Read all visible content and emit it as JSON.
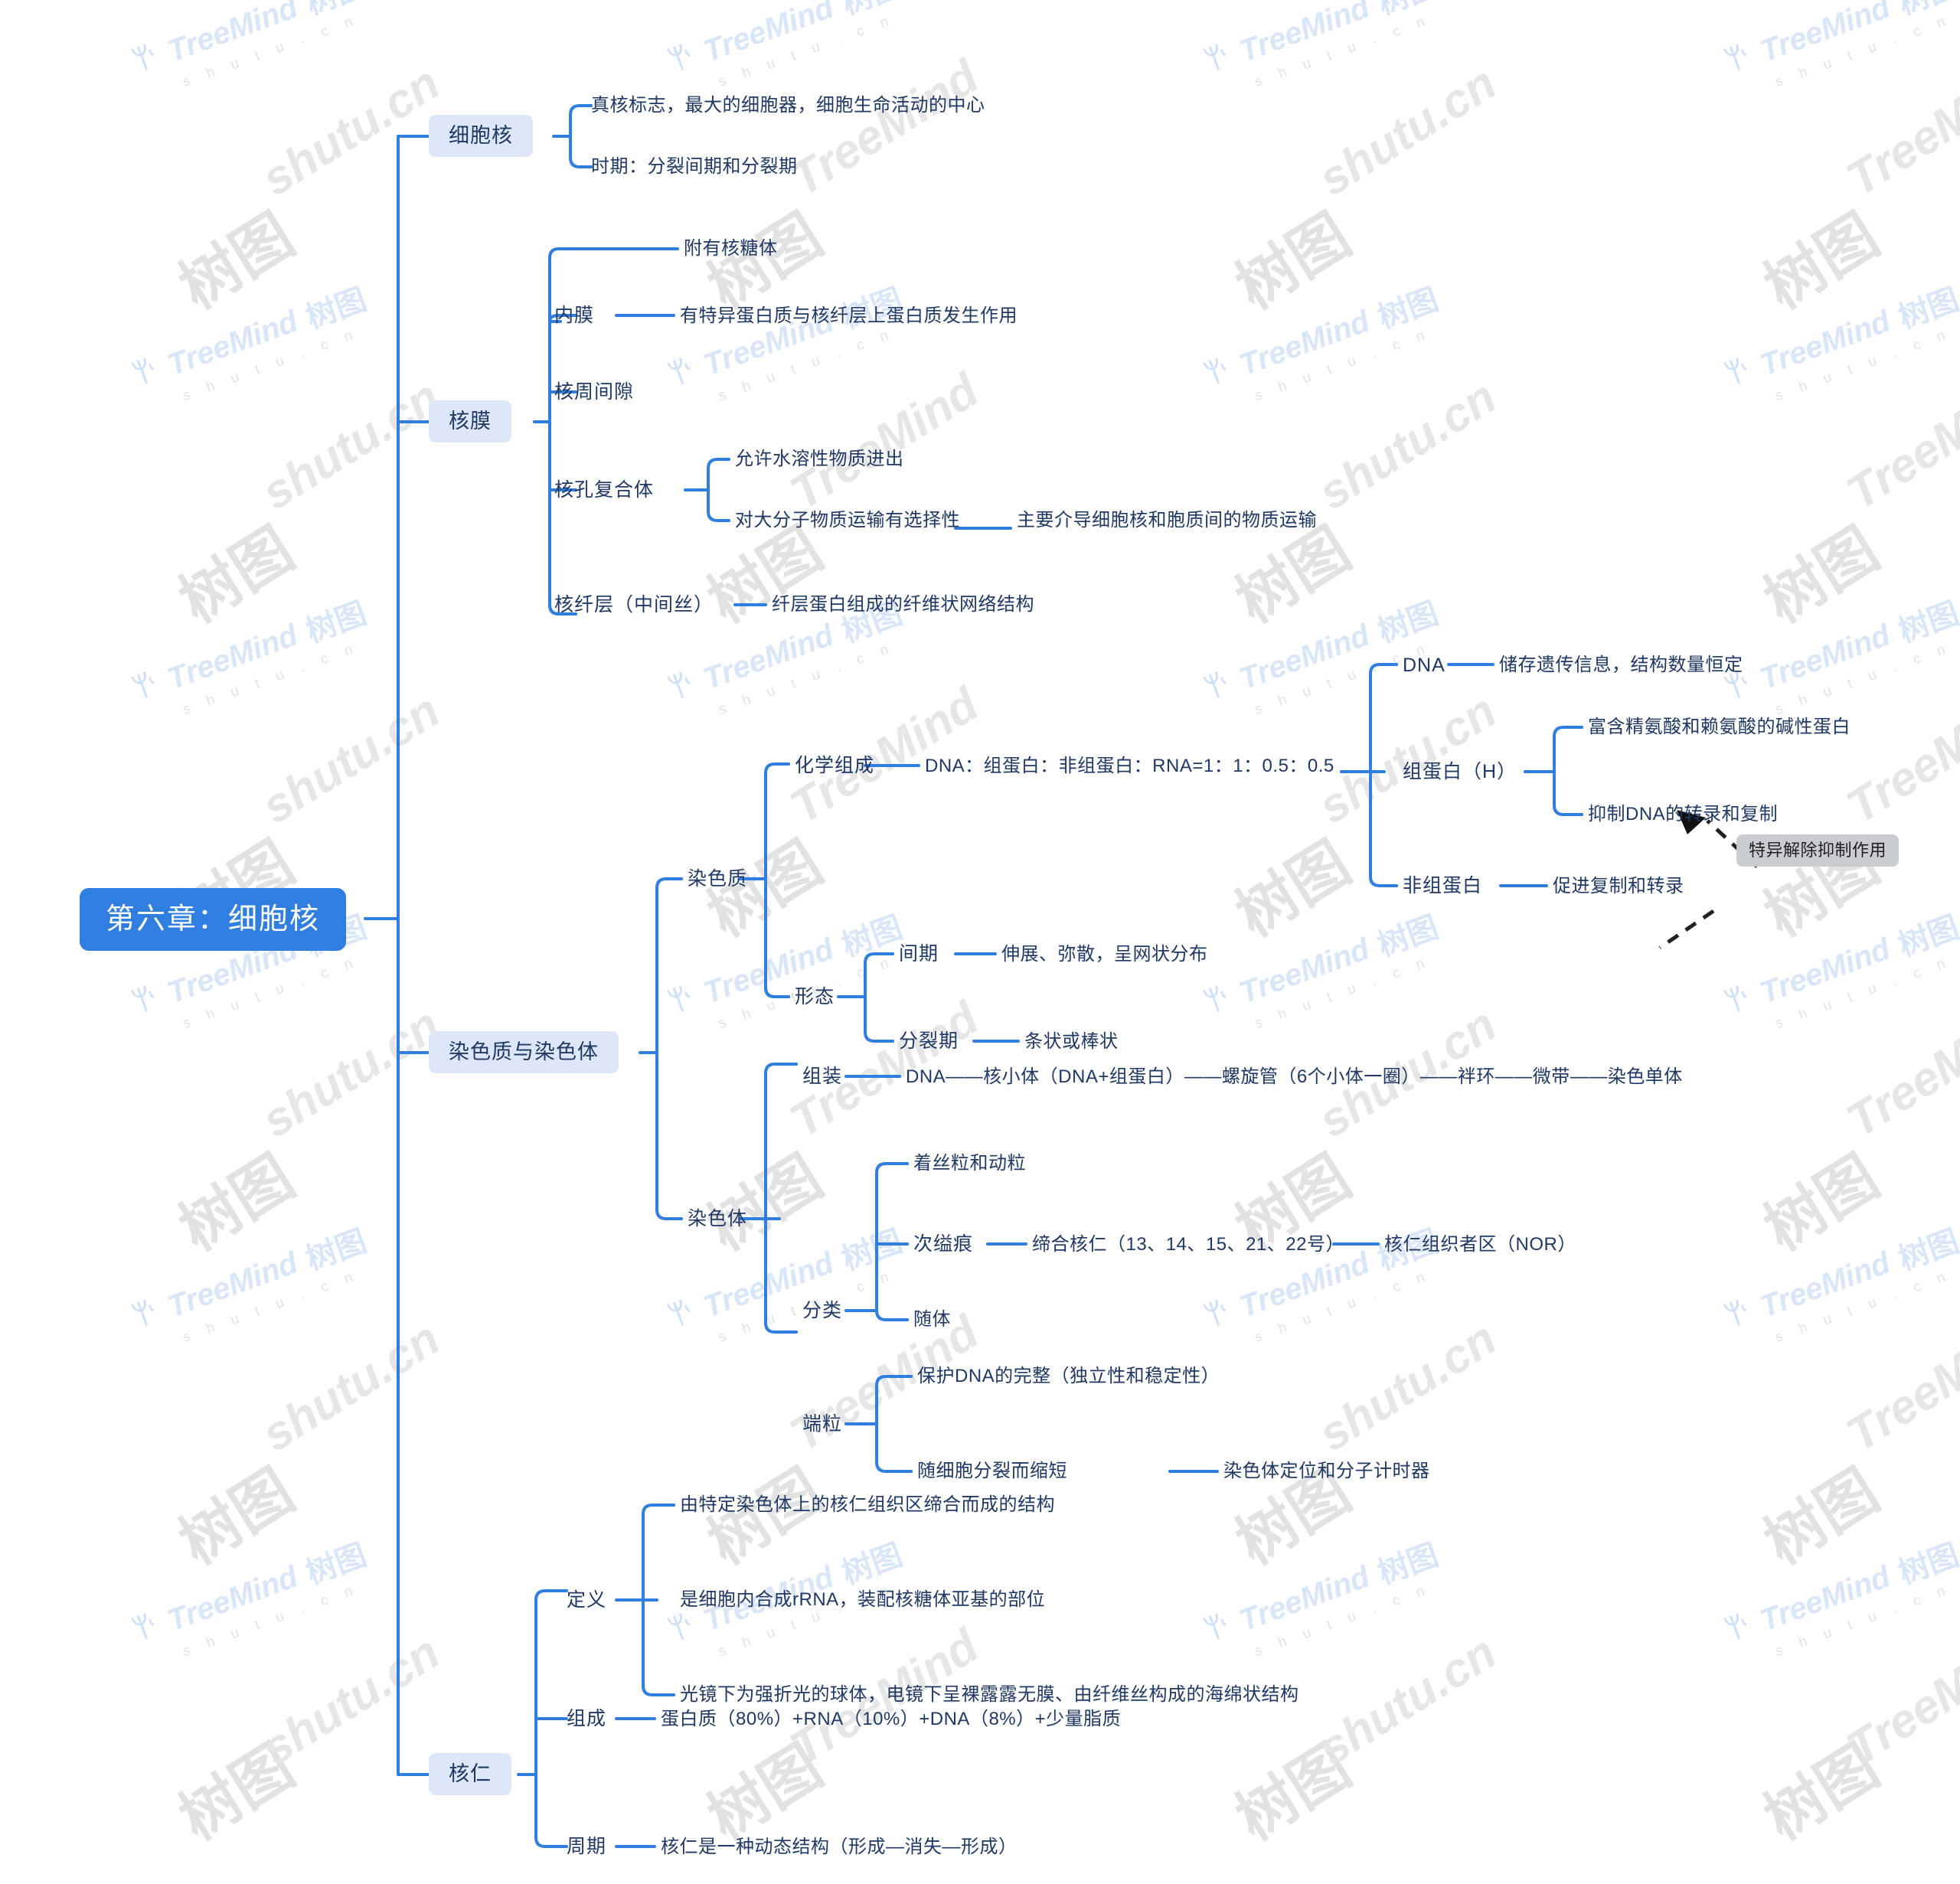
{
  "title": "第六章：细胞核",
  "root": {
    "label": "第六章：细胞核",
    "color": "#2f7ee0"
  },
  "theme": {
    "branch_color": "#2f7ee0",
    "lvl1_bg": "#dde7f9",
    "text_color": "#1f3864",
    "callout_bg": "#c9ccd1"
  },
  "watermark": {
    "brand": "TreeMind",
    "brand_cn": "树图",
    "domain": "s h u t u . c n",
    "domain_plain": "shutu.cn",
    "leaf_icon": "leaf-icon"
  },
  "branches": [
    {
      "label": "细胞核",
      "children": [
        {
          "label": "真核标志，最大的细胞器，细胞生命活动的中心"
        },
        {
          "label": "时期：分裂间期和分裂期"
        }
      ]
    },
    {
      "label": "核膜",
      "children": [
        {
          "label": "附有核糖体"
        },
        {
          "label": "内膜",
          "children": [
            {
              "label": "有特异蛋白质与核纤层上蛋白质发生作用"
            }
          ]
        },
        {
          "label": "核周间隙"
        },
        {
          "label": "核孔复合体",
          "children": [
            {
              "label": "允许水溶性物质进出"
            },
            {
              "label": "对大分子物质运输有选择性",
              "children": [
                {
                  "label": "主要介导细胞核和胞质间的物质运输"
                }
              ]
            }
          ]
        },
        {
          "label": "核纤层（中间丝）",
          "children": [
            {
              "label": "纤层蛋白组成的纤维状网络结构"
            }
          ]
        }
      ]
    },
    {
      "label": "染色质与染色体",
      "children": [
        {
          "label": "染色质",
          "children": [
            {
              "label": "化学组成",
              "children": [
                {
                  "label": "DNA：组蛋白：非组蛋白：RNA=1：1：0.5：0.5",
                  "children": [
                    {
                      "label": "DNA",
                      "children": [
                        {
                          "label": "储存遗传信息，结构数量恒定"
                        }
                      ]
                    },
                    {
                      "label": "组蛋白（H）",
                      "children": [
                        {
                          "label": "富含精氨酸和赖氨酸的碱性蛋白"
                        },
                        {
                          "label": "抑制DNA的转录和复制"
                        }
                      ]
                    },
                    {
                      "label": "非组蛋白",
                      "children": [
                        {
                          "label": "促进复制和转录"
                        }
                      ]
                    }
                  ]
                }
              ]
            },
            {
              "label": "形态",
              "children": [
                {
                  "label": "间期",
                  "children": [
                    {
                      "label": "伸展、弥散，呈网状分布"
                    }
                  ]
                },
                {
                  "label": "分裂期",
                  "children": [
                    {
                      "label": "条状或棒状"
                    }
                  ]
                }
              ]
            }
          ]
        },
        {
          "label": "染色体",
          "children": [
            {
              "label": "组装",
              "children": [
                {
                  "label": "DNA——核小体（DNA+组蛋白）——螺旋管（6个小体一圈）——袢环——微带——染色单体"
                }
              ]
            },
            {
              "label": "分类",
              "children": [
                {
                  "label": "着丝粒和动粒"
                },
                {
                  "label": "次缢痕",
                  "children": [
                    {
                      "label": "缔合核仁（13、14、15、21、22号）",
                      "children": [
                        {
                          "label": "核仁组织者区（NOR）"
                        }
                      ]
                    }
                  ]
                },
                {
                  "label": "随体"
                }
              ]
            },
            {
              "label": "端粒",
              "children": [
                {
                  "label": "保护DNA的完整（独立性和稳定性）"
                },
                {
                  "label": "随细胞分裂而缩短",
                  "children": [
                    {
                      "label": "染色体定位和分子计时器"
                    }
                  ]
                }
              ]
            }
          ]
        }
      ]
    },
    {
      "label": "核仁",
      "children": [
        {
          "label": "定义",
          "children": [
            {
              "label": "由特定染色体上的核仁组织区缔合而成的结构"
            },
            {
              "label": "是细胞内合成rRNA，装配核糖体亚基的部位"
            },
            {
              "label": "光镜下为强折光的球体，电镜下呈裸露露无膜、由纤维丝构成的海绵状结构"
            }
          ]
        },
        {
          "label": "组成",
          "children": [
            {
              "label": "蛋白质（80%）+RNA（10%）+DNA（8%）+少量脂质"
            }
          ]
        },
        {
          "label": "周期",
          "children": [
            {
              "label": "核仁是一种动态结构（形成—消失—形成）"
            }
          ]
        }
      ]
    }
  ],
  "callout": {
    "label": "特异解除抑制作用"
  },
  "nodes": {
    "cell_nucleus": "细胞核",
    "n_true_marker": "真核标志，最大的细胞器，细胞生命活动的中心",
    "n_period": "时期：分裂间期和分裂期",
    "nuclear_membrane": "核膜",
    "n_ribosome": "附有核糖体",
    "n_inner": "内膜",
    "n_inner_desc": "有特异蛋白质与核纤层上蛋白质发生作用",
    "n_perinuclear": "核周间隙",
    "n_pore": "核孔复合体",
    "n_pore_a": "允许水溶性物质进出",
    "n_pore_b": "对大分子物质运输有选择性",
    "n_pore_b_desc": "主要介导细胞核和胞质间的物质运输",
    "n_lamina": "核纤层（中间丝）",
    "n_lamina_desc": "纤层蛋白组成的纤维状网络结构",
    "chromatin_chromosome": "染色质与染色体",
    "chromatin": "染色质",
    "chem_comp": "化学组成",
    "chem_comp_desc": "DNA：组蛋白：非组蛋白：RNA=1：1：0.5：0.5",
    "dna": "DNA",
    "dna_desc": "储存遗传信息，结构数量恒定",
    "histone": "组蛋白（H）",
    "histone_a": "富含精氨酸和赖氨酸的碱性蛋白",
    "histone_b": "抑制DNA的转录和复制",
    "nonhistone": "非组蛋白",
    "nonhistone_desc": "促进复制和转录",
    "morphology": "形态",
    "interphase": "间期",
    "interphase_desc": "伸展、弥散，呈网状分布",
    "mitosis": "分裂期",
    "mitosis_desc": "条状或棒状",
    "chromosome": "染色体",
    "assembly": "组装",
    "assembly_desc": "DNA——核小体（DNA+组蛋白）——螺旋管（6个小体一圈）——袢环——微带——染色单体",
    "classification": "分类",
    "centromere": "着丝粒和动粒",
    "secondary": "次缢痕",
    "secondary_desc": "缔合核仁（13、14、15、21、22号）",
    "nor": "核仁组织者区（NOR）",
    "satellite": "随体",
    "telomere": "端粒",
    "telomere_a": "保护DNA的完整（独立性和稳定性）",
    "telomere_b": "随细胞分裂而缩短",
    "telomere_b_desc": "染色体定位和分子计时器",
    "nucleolus": "核仁",
    "definition": "定义",
    "def_a": "由特定染色体上的核仁组织区缔合而成的结构",
    "def_b": "是细胞内合成rRNA，装配核糖体亚基的部位",
    "def_c": "光镜下为强折光的球体，电镜下呈裸露露无膜、由纤维丝构成的海绵状结构",
    "composition": "组成",
    "composition_desc": "蛋白质（80%）+RNA（10%）+DNA（8%）+少量脂质",
    "cycle": "周期",
    "cycle_desc": "核仁是一种动态结构（形成—消失—形成）",
    "callout_text": "特异解除抑制作用"
  }
}
